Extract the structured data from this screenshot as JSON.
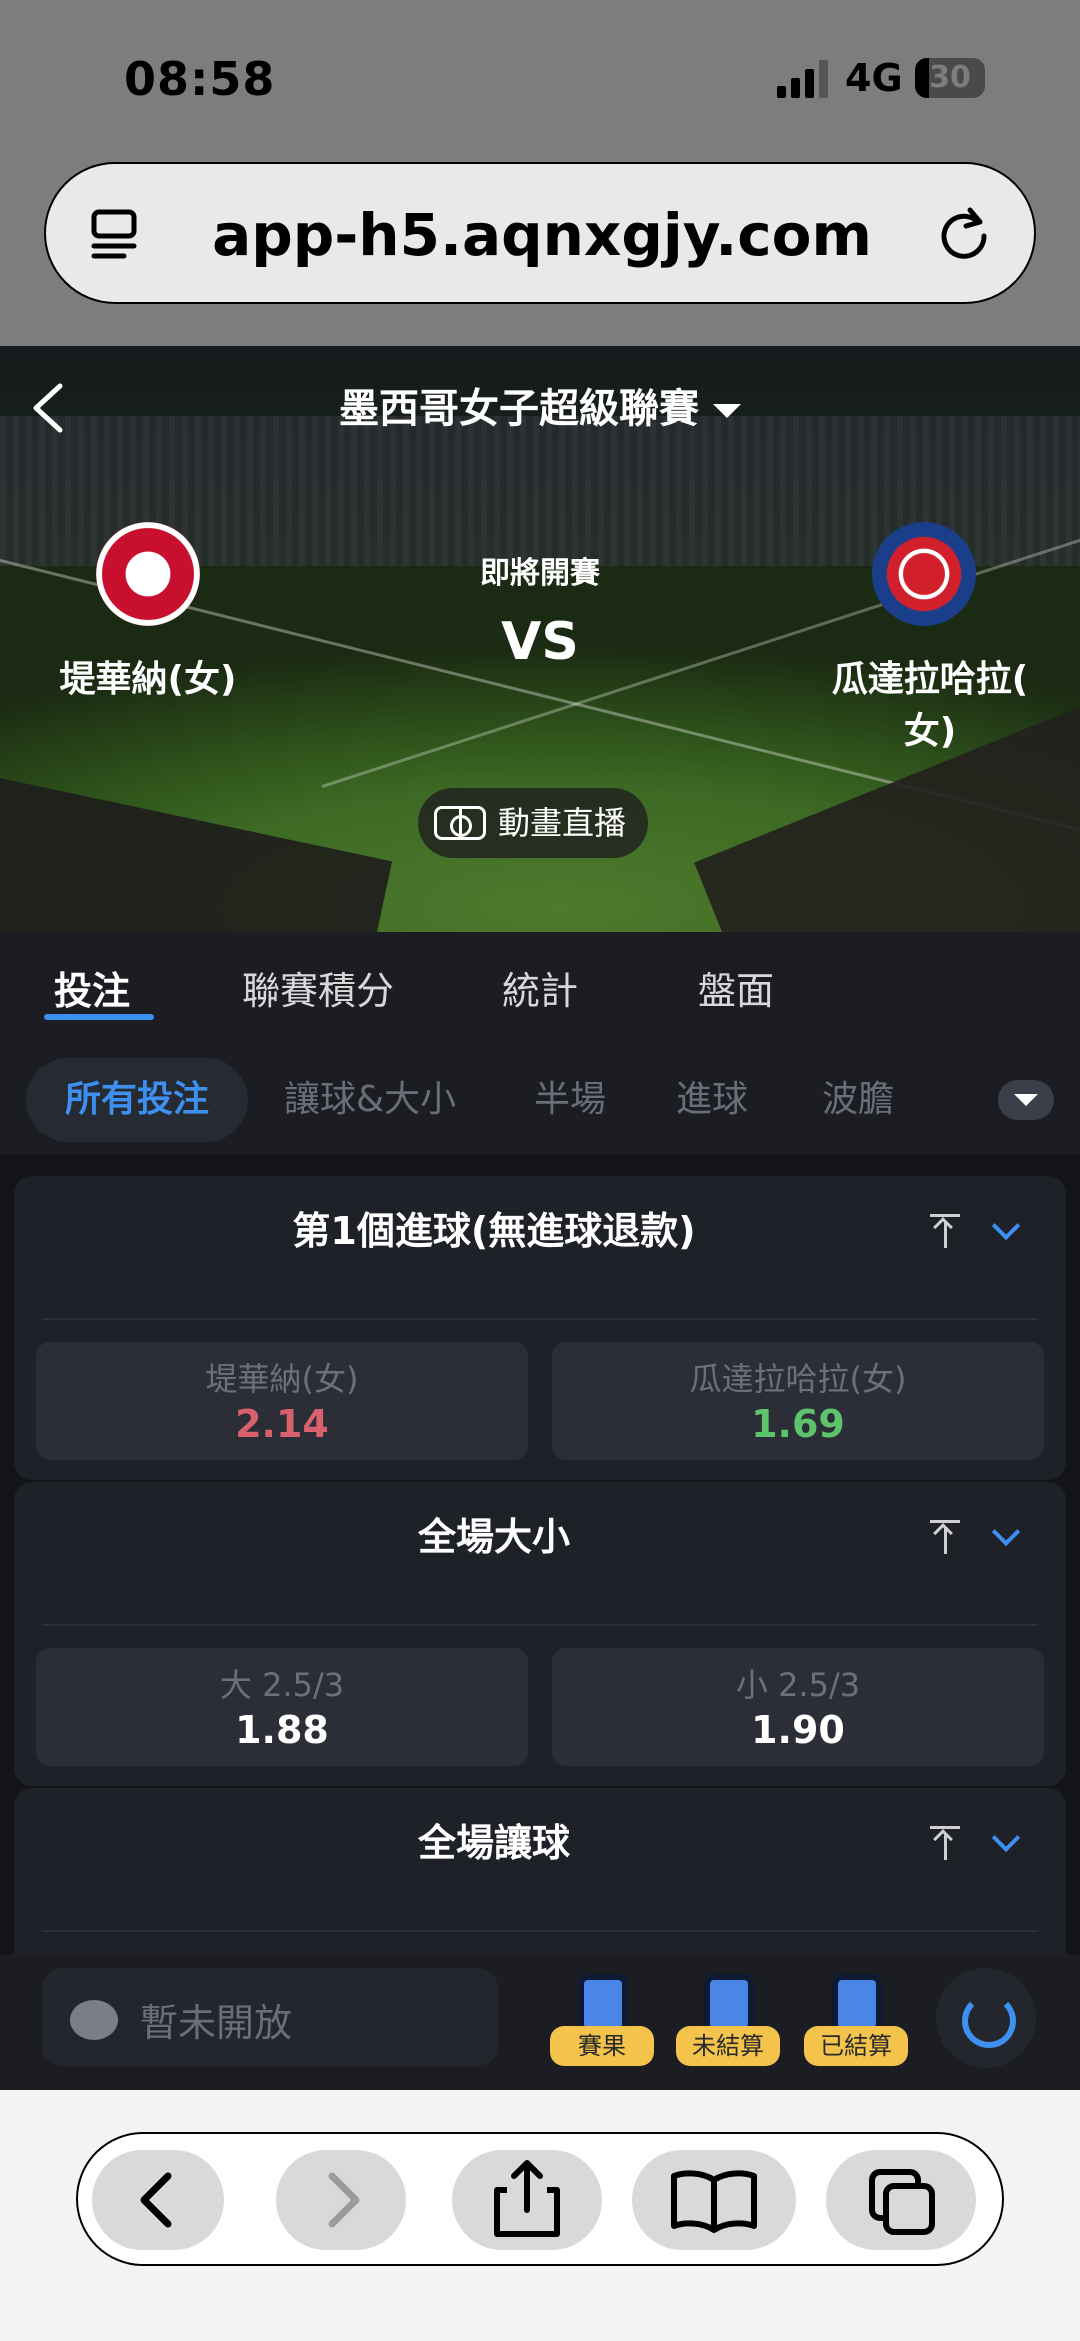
{
  "status_bar": {
    "time": "08:58",
    "network": "4G",
    "battery": "30"
  },
  "browser": {
    "url": "app-h5.aqnxgjy.com"
  },
  "match": {
    "league": "墨西哥女子超級聯賽",
    "status": "即將開賽",
    "vs": "VS",
    "home_team": "堤華納(女)",
    "away_team": "瓜達拉哈拉(女)",
    "away_team_line1": "瓜達拉哈拉(",
    "away_team_line2": "女)",
    "live_label": "動畫直播"
  },
  "main_tabs": [
    {
      "label": "投注",
      "active": true
    },
    {
      "label": "聯賽積分",
      "active": false
    },
    {
      "label": "統計",
      "active": false
    },
    {
      "label": "盤面",
      "active": false
    }
  ],
  "filters": [
    {
      "label": "所有投注",
      "active": true
    },
    {
      "label": "讓球&大小",
      "active": false
    },
    {
      "label": "半場",
      "active": false
    },
    {
      "label": "進球",
      "active": false
    },
    {
      "label": "波膽",
      "active": false
    }
  ],
  "markets": [
    {
      "title": "第1個進球(無進球退款)",
      "options": [
        {
          "label": "堤華納(女)",
          "odds": "2.14",
          "color": "#d9606d"
        },
        {
          "label": "瓜達拉哈拉(女)",
          "odds": "1.69",
          "color": "#5ec46c"
        }
      ]
    },
    {
      "title": "全場大小",
      "options": [
        {
          "label": "大 2.5/3",
          "odds": "1.88",
          "color": "#ffffff"
        },
        {
          "label": "小 2.5/3",
          "odds": "1.90",
          "color": "#ffffff"
        }
      ]
    },
    {
      "title": "全場讓球",
      "options": []
    }
  ],
  "bottom_bar": {
    "chat_placeholder": "暫未開放",
    "buttons": [
      {
        "label": "賽果"
      },
      {
        "label": "未結算"
      },
      {
        "label": "已結算"
      }
    ]
  },
  "colors": {
    "accent": "#3d8ff0",
    "odds_up": "#d9606d",
    "odds_down": "#5ec46c",
    "tag": "#f3c34b"
  }
}
